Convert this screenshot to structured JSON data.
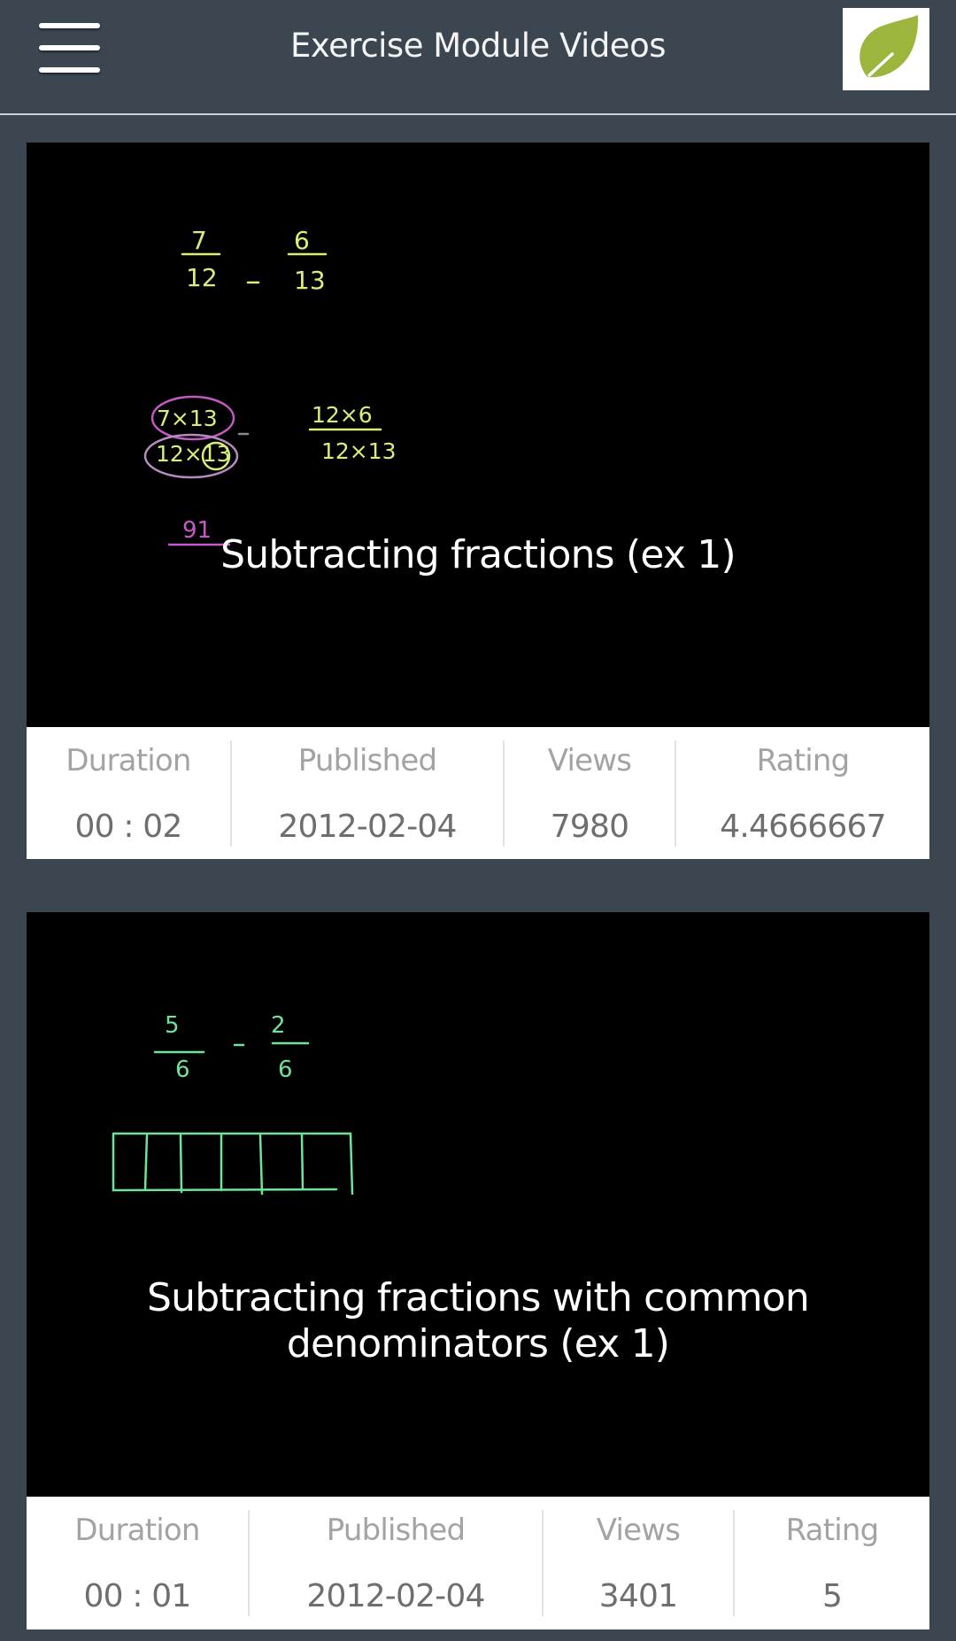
{
  "header": {
    "title": "Exercise Module Videos",
    "menu_icon": "hamburger-menu-icon",
    "logo_icon": "leaf-logo-icon",
    "logo_color": "#9cb53c"
  },
  "stat_labels": {
    "duration": "Duration",
    "published": "Published",
    "views": "Views",
    "rating": "Rating"
  },
  "videos": [
    {
      "title": "Subtracting fractions (ex 1)",
      "duration": "00 : 02",
      "published": "2012-02-04",
      "views": "7980",
      "rating": "4.4666667",
      "board": {
        "line1": [
          "7",
          "12",
          "-",
          "6",
          "13"
        ],
        "line2": [
          "7x13",
          "12x13",
          "-",
          "12x6",
          "12x13"
        ],
        "line3": "91"
      }
    },
    {
      "title": "Subtracting fractions with common denominators (ex 1)",
      "duration": "00 : 01",
      "published": "2012-02-04",
      "views": "3401",
      "rating": "5",
      "board": {
        "line1": [
          "5",
          "6",
          "-",
          "2",
          "6"
        ]
      }
    }
  ],
  "colors": {
    "background": "#3b4651",
    "chalk_yellow": "#d7ef7a",
    "chalk_magenta": "#c25bc4",
    "chalk_green": "#6fe39a"
  }
}
